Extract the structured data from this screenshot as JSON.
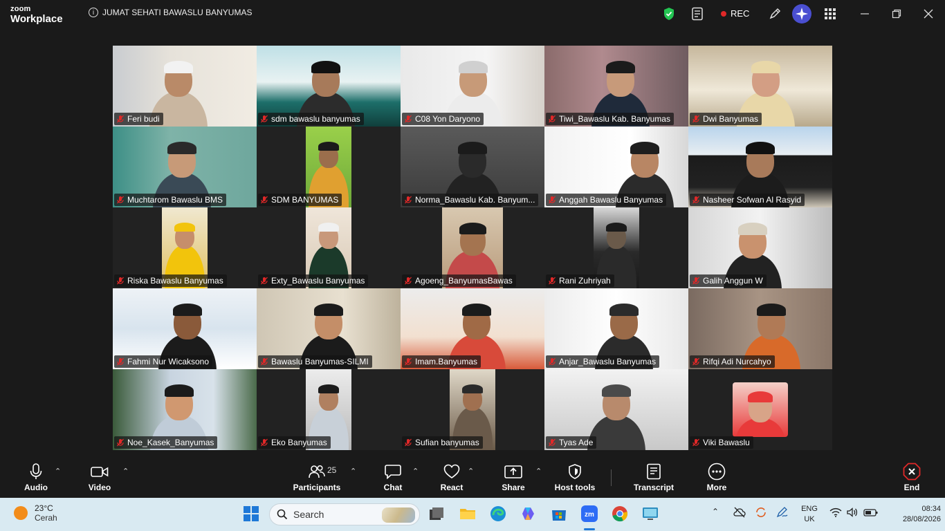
{
  "titlebar": {
    "brand_top": "zoom",
    "brand_bottom": "Workplace",
    "meeting_title": "JUMAT SEHATI BAWASLU BANYUMAS",
    "rec_label": "REC",
    "shield_color": "#23c552",
    "rec_color": "#e02828"
  },
  "participants": [
    {
      "name": "Feri budi"
    },
    {
      "name": "sdm bawaslu banyumas",
      "active": true
    },
    {
      "name": "C08 Yon Daryono"
    },
    {
      "name": "Tiwi_Bawaslu Kab. Banyumas"
    },
    {
      "name": "Dwi Banyumas"
    },
    {
      "name": "Muchtarom Bawaslu BMS"
    },
    {
      "name": "SDM BANYUMAS"
    },
    {
      "name": "Norma_Bawaslu Kab. Banyum..."
    },
    {
      "name": "Anggah Bawaslu Banyumas"
    },
    {
      "name": "Nasheer Sofwan Al Rasyid"
    },
    {
      "name": "Riska Bawaslu Banyumas"
    },
    {
      "name": "Exty_Bawaslu Banyumas"
    },
    {
      "name": "Agoeng_BanyumasBawas"
    },
    {
      "name": "Rani Zuhriyah"
    },
    {
      "name": "Galih Anggun W"
    },
    {
      "name": "Fahmi Nur Wicaksono"
    },
    {
      "name": "Bawaslu Banyumas-SILMI"
    },
    {
      "name": "Imam.Banyumas"
    },
    {
      "name": "Anjar_Bawaslu Banyumas"
    },
    {
      "name": "Rifqi Adi Nurcahyo"
    },
    {
      "name": "Noe_Kasek_Banyumas"
    },
    {
      "name": "Eko Banyumas"
    },
    {
      "name": "Sufian banyumas"
    },
    {
      "name": "Tyas Ade"
    },
    {
      "name": "Viki Bawaslu"
    }
  ],
  "controls": {
    "audio": "Audio",
    "video": "Video",
    "participants": "Participants",
    "participants_count": "25",
    "chat": "Chat",
    "react": "React",
    "share": "Share",
    "host_tools": "Host tools",
    "transcript": "Transcript",
    "more": "More",
    "end": "End",
    "end_color": "#e02828"
  },
  "taskbar": {
    "weather_temp": "23°C",
    "weather_desc": "Cerah",
    "search_placeholder": "Search",
    "lang_top": "ENG",
    "lang_bottom": "UK",
    "time": "08:34",
    "date": "28/08/2026"
  }
}
